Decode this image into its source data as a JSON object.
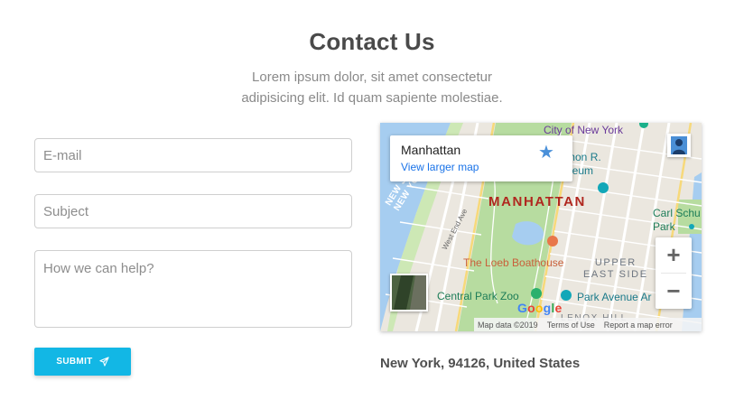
{
  "header": {
    "title": "Contact Us",
    "subtitle_line1": "Lorem ipsum dolor, sit amet consectetur",
    "subtitle_line2": "adipisicing elit. Id quam sapiente molestiae."
  },
  "form": {
    "email_placeholder": "E-mail",
    "subject_placeholder": "Subject",
    "message_placeholder": "How we can help?",
    "submit_label": "SUBMIT",
    "submit_icon": "paper-plane-icon",
    "accent_color": "#12b7e5"
  },
  "map": {
    "info_title": "Manhattan",
    "info_link": "View larger map",
    "labels": {
      "manhattan": "MANHATTAN",
      "city_of_new_york": "City of New York",
      "museum_line1": "olomon R.",
      "museum_line2": "Museum",
      "loeb_boathouse": "The Loeb Boathouse",
      "upper_east_side_line1": "UPPER",
      "upper_east_side_line2": "EAST SIDE",
      "central_park_zoo": "Central Park Zoo",
      "park_avenue": "Park Avenue Ar",
      "carl_schurz_line1": "Carl Schu",
      "carl_schurz_line2": "Park",
      "lenox_hill": "LENOX HILL",
      "new_jersey_line1": "NEW JERSEY",
      "new_jersey_line2": "NEW YORK",
      "west_end_ave": "West End Ave"
    },
    "zoom_in_label": "+",
    "zoom_out_label": "−",
    "google_letters": [
      "G",
      "o",
      "o",
      "g",
      "l",
      "e"
    ],
    "google_colors": [
      "#4285f4",
      "#ea4335",
      "#fbbc05",
      "#4285f4",
      "#34a853",
      "#ea4335"
    ],
    "map_data": "Map data ©2019",
    "terms": "Terms of Use",
    "report": "Report a map error"
  },
  "address": "New York, 94126, United States"
}
